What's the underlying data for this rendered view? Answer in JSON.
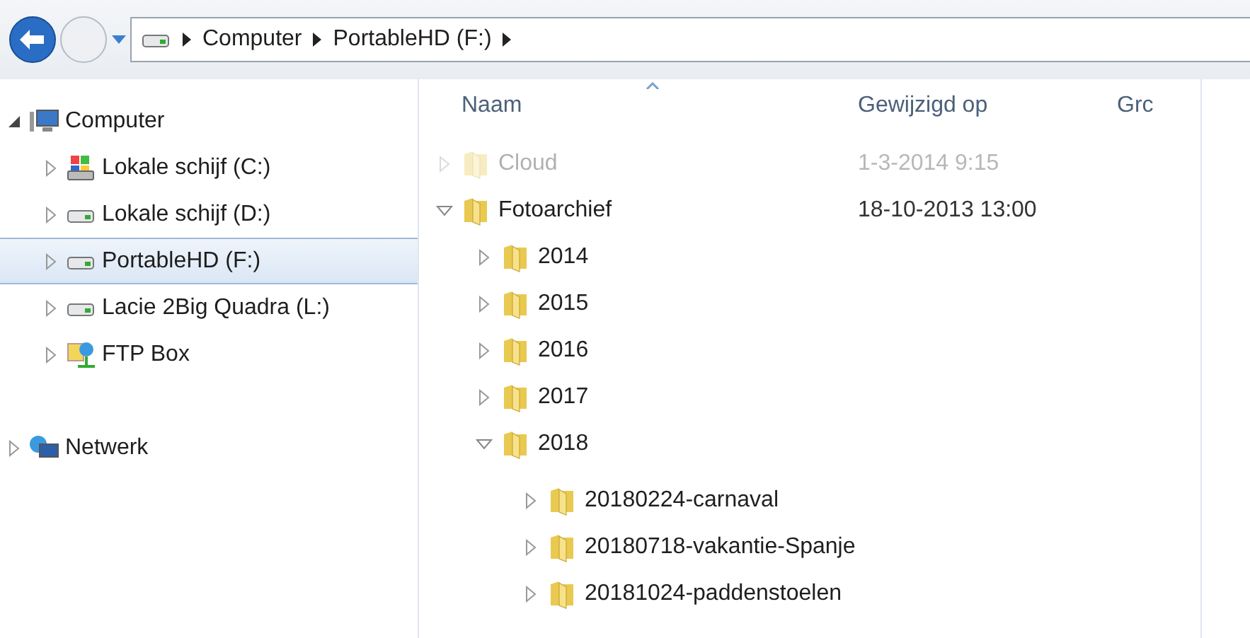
{
  "address_bar": {
    "crumbs": [
      "Computer",
      "PortableHD (F:)"
    ]
  },
  "navigation_pane": {
    "items": [
      {
        "label": "Computer",
        "kind": "computer",
        "expanded": true,
        "selected": false,
        "children": [
          {
            "label": "Lokale schijf (C:)",
            "kind": "system-drive",
            "expanded": false,
            "selected": false
          },
          {
            "label": "Lokale schijf (D:)",
            "kind": "drive",
            "expanded": false,
            "selected": false
          },
          {
            "label": "PortableHD (F:)",
            "kind": "drive",
            "expanded": false,
            "selected": true
          },
          {
            "label": "Lacie 2Big Quadra (L:)",
            "kind": "drive",
            "expanded": false,
            "selected": false
          },
          {
            "label": "FTP Box",
            "kind": "network-place",
            "expanded": false,
            "selected": false
          }
        ]
      },
      {
        "label": "Netwerk",
        "kind": "network",
        "expanded": false,
        "selected": false
      }
    ]
  },
  "file_list": {
    "columns": [
      "Naam",
      "Gewijzigd op",
      "Grc"
    ],
    "rows": [
      {
        "name": "Cloud",
        "modified": "1-3-2014 9:15",
        "expanded": false,
        "hidden": true
      },
      {
        "name": "Fotoarchief",
        "modified": "18-10-2013 13:00",
        "expanded": true,
        "hidden": false,
        "children": [
          {
            "name": "2014",
            "expanded": false,
            "hidden": false
          },
          {
            "name": "2015",
            "expanded": false,
            "hidden": false
          },
          {
            "name": "2016",
            "expanded": false,
            "hidden": false
          },
          {
            "name": "2017",
            "expanded": false,
            "hidden": false
          },
          {
            "name": "2018",
            "expanded": true,
            "hidden": false,
            "children": [
              {
                "name": "20180224-carnaval",
                "expanded": false,
                "hidden": false
              },
              {
                "name": "20180718-vakantie-Spanje",
                "expanded": false,
                "hidden": false
              },
              {
                "name": "20181024-paddenstoelen",
                "expanded": false,
                "hidden": false
              }
            ]
          }
        ]
      }
    ]
  }
}
